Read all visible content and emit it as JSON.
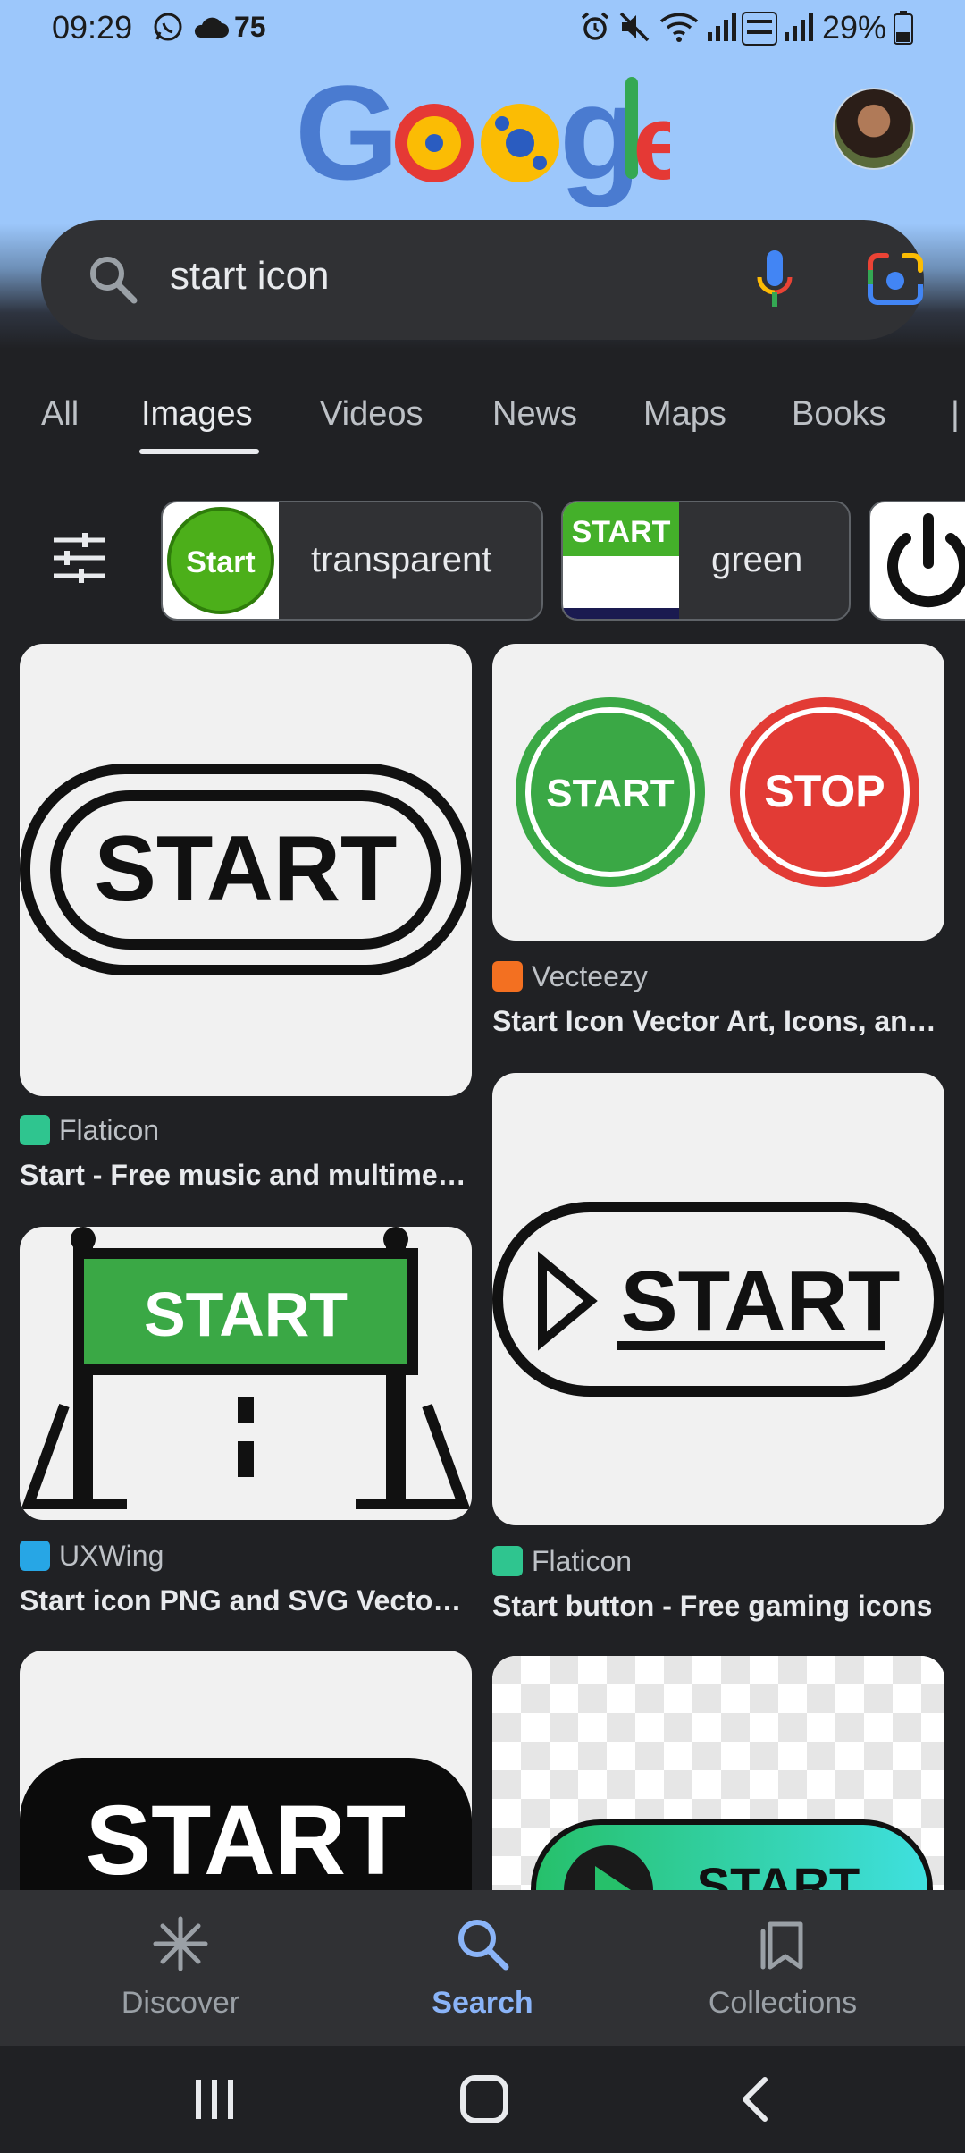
{
  "status_bar": {
    "time": "09:29",
    "temperature": "75",
    "battery": "29%"
  },
  "search": {
    "query": "start icon"
  },
  "tabs": [
    {
      "label": "All"
    },
    {
      "label": "Images",
      "active": true
    },
    {
      "label": "Videos"
    },
    {
      "label": "News"
    },
    {
      "label": "Maps"
    },
    {
      "label": "Books"
    }
  ],
  "filter_chips": [
    {
      "label": "transparent",
      "thumb_text": "Start"
    },
    {
      "label": "green",
      "thumb_text": "START"
    }
  ],
  "results": {
    "r1": {
      "source": "Flaticon",
      "title": "Start - Free music and multimed…",
      "image_text": "START"
    },
    "r2": {
      "source": "Vecteezy",
      "title": "Start Icon Vector Art, Icons, and…",
      "image_text_a": "START",
      "image_text_b": "STOP"
    },
    "r3": {
      "source": "UXWing",
      "title": "Start icon PNG and SVG Vector …",
      "image_text": "START"
    },
    "r4": {
      "source": "Flaticon",
      "title": "Start button - Free gaming icons",
      "image_text": "START"
    },
    "r5": {
      "image_text": "START"
    },
    "r6": {
      "image_text": "START"
    }
  },
  "bottom_nav": [
    {
      "label": "Discover",
      "icon": "asterisk-icon"
    },
    {
      "label": "Search",
      "icon": "search-icon",
      "active": true
    },
    {
      "label": "Collections",
      "icon": "collections-icon"
    }
  ],
  "colors": {
    "background": "#202124",
    "search_bar": "#303134",
    "accent": "#8ab4f8",
    "start_green": "#3aa845",
    "stop_red": "#e23b35"
  }
}
